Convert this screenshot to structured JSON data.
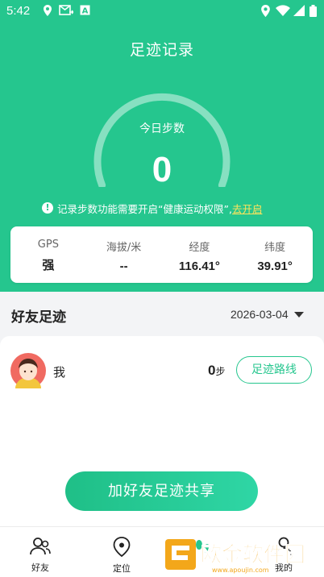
{
  "status_bar": {
    "time": "5:42"
  },
  "header": {
    "title": "足迹记录"
  },
  "gauge": {
    "label": "今日步数",
    "steps": "0",
    "progress": 0
  },
  "notice": {
    "text": "记录步数功能需要开启“健康运动权限”,",
    "link": "去开启"
  },
  "stats": [
    {
      "label": "GPS",
      "value": "强"
    },
    {
      "label": "海拔/米",
      "value": "--"
    },
    {
      "label": "经度",
      "value": "116.41°"
    },
    {
      "label": "纬度",
      "value": "39.91°"
    }
  ],
  "friends_section": {
    "title": "好友足迹",
    "date": "2026-03-04"
  },
  "friends": [
    {
      "name": "我",
      "steps": "0",
      "steps_unit": "步",
      "route_button": "足迹路线"
    }
  ],
  "add_friend_button": "加好友足迹共享",
  "tabs": [
    {
      "label": "好友",
      "icon": "friends-icon"
    },
    {
      "label": "定位",
      "icon": "location-pin-icon"
    },
    {
      "label": "",
      "icon": "footprint-icon"
    },
    {
      "label": "我的",
      "icon": "profile-icon"
    }
  ],
  "watermark": {
    "text": "欧金软件园",
    "url": "www.apoujin.com"
  },
  "colors": {
    "accent": "#25c68e",
    "link": "#ffe45c"
  }
}
